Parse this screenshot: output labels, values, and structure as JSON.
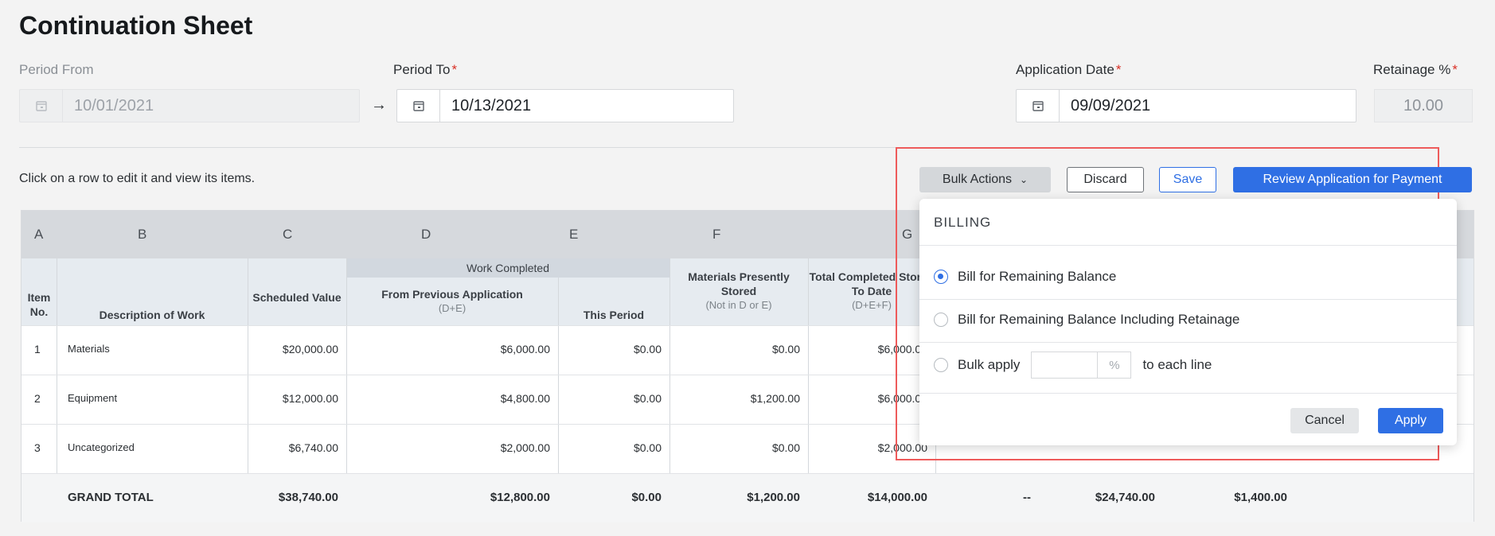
{
  "page": {
    "title": "Continuation Sheet",
    "hint": "Click on a row to edit it and view its items."
  },
  "fields": {
    "period_from": {
      "label": "Period From",
      "value": "10/01/2021"
    },
    "period_to": {
      "label": "Period To",
      "value": "10/13/2021",
      "required": "*"
    },
    "application_date": {
      "label": "Application Date",
      "value": "09/09/2021",
      "required": "*"
    },
    "retainage": {
      "label": "Retainage %",
      "value": "10.00",
      "required": "*"
    },
    "arrow": "→"
  },
  "toolbar": {
    "bulk_actions": "Bulk Actions",
    "discard": "Discard",
    "save": "Save",
    "review": "Review Application for Payment"
  },
  "dropdown": {
    "heading": "BILLING",
    "option1": "Bill for Remaining Balance",
    "option2": "Bill for Remaining Balance Including Retainage",
    "option3_prefix": "Bulk apply",
    "option3_unit": "%",
    "option3_suffix": "to each line",
    "cancel": "Cancel",
    "apply": "Apply"
  },
  "table": {
    "letters": [
      "A",
      "B",
      "C",
      "D",
      "E",
      "F",
      "G"
    ],
    "headers": {
      "item_no": "Item No.",
      "description": "Description of Work",
      "scheduled": "Scheduled Value",
      "work_completed": "Work Completed",
      "from_previous": "From Previous Application",
      "from_previous_sub": "(D+E)",
      "this_period": "This Period",
      "materials": "Materials Presently Stored",
      "materials_sub": "(Not in D or E)",
      "total_completed": "Total Completed Stored To Date",
      "total_completed_sub": "(D+E+F)"
    },
    "rows": [
      {
        "no": "1",
        "desc": "Materials",
        "scheduled": "$20,000.00",
        "previous": "$6,000.00",
        "this_period": "$0.00",
        "materials": "$0.00",
        "total": "$6,000.00"
      },
      {
        "no": "2",
        "desc": "Equipment",
        "scheduled": "$12,000.00",
        "previous": "$4,800.00",
        "this_period": "$0.00",
        "materials": "$1,200.00",
        "total": "$6,000.00"
      },
      {
        "no": "3",
        "desc": "Uncategorized",
        "scheduled": "$6,740.00",
        "previous": "$2,000.00",
        "this_period": "$0.00",
        "materials": "$0.00",
        "total": "$2,000.00"
      }
    ],
    "grand_total": {
      "label": "GRAND TOTAL",
      "scheduled": "$38,740.00",
      "previous": "$12,800.00",
      "this_period": "$0.00",
      "materials": "$1,200.00",
      "total": "$14,000.00",
      "pct": "--",
      "balance": "$24,740.00",
      "retainage": "$1,400.00"
    }
  }
}
